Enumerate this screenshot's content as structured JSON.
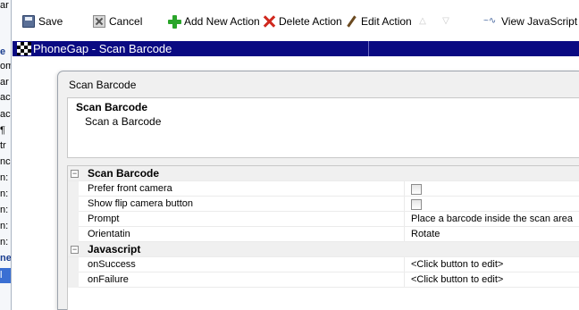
{
  "sidebar": {
    "fragments": [
      "ar",
      "e",
      "om",
      "ar",
      "ac",
      "ac",
      "¶",
      "tr",
      "nc",
      "n:",
      "n:",
      "n:",
      "n:",
      "n:",
      "ne",
      "l"
    ]
  },
  "toolbar": {
    "save_label": "Save",
    "cancel_label": "Cancel",
    "add_label": "Add New Action",
    "delete_label": "Delete Action",
    "edit_label": "Edit Action",
    "up_glyph": "△",
    "down_glyph": "▽",
    "js_glyph": "~∿",
    "js_label": "View JavaScript"
  },
  "titlebar": {
    "title": "PhoneGap - Scan Barcode"
  },
  "dialog": {
    "title": "Scan Barcode",
    "description_title": "Scan Barcode",
    "description_text": "Scan a Barcode"
  },
  "property_grid": {
    "categories": [
      {
        "label": "Scan Barcode",
        "toggle": "⊟"
      },
      {
        "label": "Javascript",
        "toggle": "⊟"
      }
    ],
    "properties": [
      {
        "name": "Prefer front camera",
        "type": "checkbox",
        "checked": false
      },
      {
        "name": "Show flip camera button",
        "type": "checkbox",
        "checked": false
      },
      {
        "name": "Prompt",
        "type": "text",
        "value": "Place a barcode inside the scan area"
      },
      {
        "name": "Orientatin",
        "type": "text",
        "value": "Rotate"
      },
      {
        "name": "onSuccess",
        "type": "text",
        "value": "<Click button to edit>"
      },
      {
        "name": "onFailure",
        "type": "text",
        "value": "<Click button to edit>"
      }
    ]
  }
}
